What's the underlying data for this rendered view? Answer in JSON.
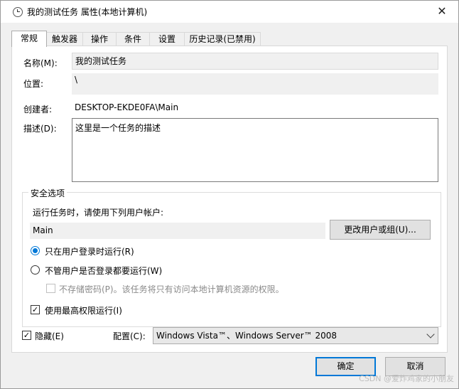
{
  "window": {
    "title": "我的测试任务 属性(本地计算机)",
    "close_glyph": "✕"
  },
  "tabs": [
    {
      "label": "常规"
    },
    {
      "label": "触发器"
    },
    {
      "label": "操作"
    },
    {
      "label": "条件"
    },
    {
      "label": "设置"
    },
    {
      "label": "历史记录(已禁用)"
    }
  ],
  "general": {
    "name_label": "名称(M):",
    "name_value": "我的测试任务",
    "location_label": "位置:",
    "location_value": "\\",
    "author_label": "创建者:",
    "author_value": "DESKTOP-EKDE0FA\\Main",
    "description_label": "描述(D):",
    "description_value": "这里是一个任务的描述"
  },
  "security": {
    "group_title": "安全选项",
    "run_as_prompt": "运行任务时，请使用下列用户帐户:",
    "user_value": "Main",
    "change_user_button": "更改用户或组(U)...",
    "radio_logged_on": "只在用户登录时运行(R)",
    "radio_whether_logged": "不管用户是否登录都要运行(W)",
    "no_store_password": "不存储密码(P)。该任务将只有访问本地计算机资源的权限。",
    "highest_privileges": "使用最高权限运行(I)"
  },
  "footer": {
    "hidden_label": "隐藏(E)",
    "configure_label": "配置(C):",
    "configure_value": "Windows Vista™、Windows Server™ 2008"
  },
  "buttons": {
    "ok": "确定",
    "cancel": "取消"
  },
  "watermark": "CSDN @爱炸鸡家的小朋友"
}
